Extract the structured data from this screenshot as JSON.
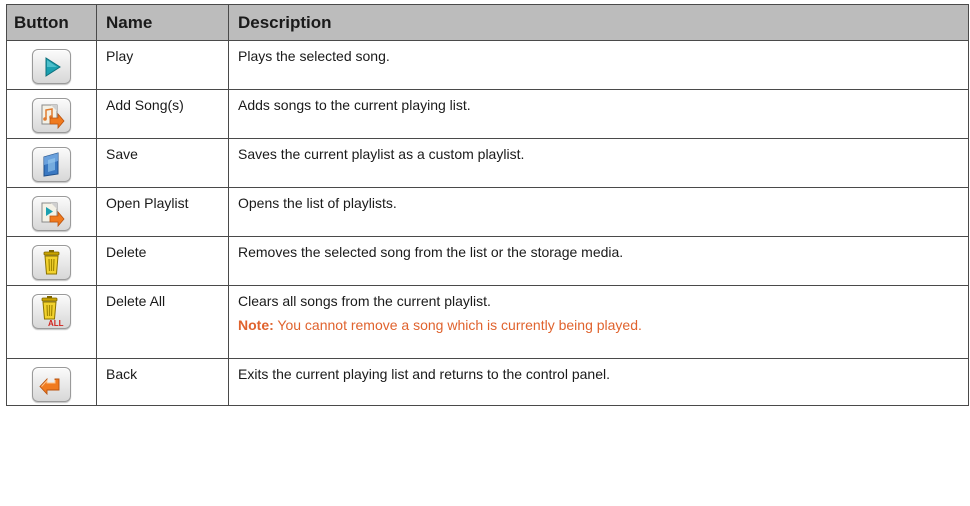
{
  "header": {
    "button": "Button",
    "name": "Name",
    "description": "Description"
  },
  "rows": [
    {
      "icon": "play-icon",
      "name": "Play",
      "description": "Plays the selected song."
    },
    {
      "icon": "add-songs-icon",
      "name": "Add Song(s)",
      "description": "Adds songs to the current playing list."
    },
    {
      "icon": "save-icon",
      "name": "Save",
      "description": "Saves the current playlist as a custom playlist."
    },
    {
      "icon": "open-playlist-icon",
      "name": "Open Playlist",
      "description": "Opens the list of playlists."
    },
    {
      "icon": "delete-icon",
      "name": "Delete",
      "description": "Removes the selected song from the list or the storage media."
    },
    {
      "icon": "delete-all-icon",
      "name": "Delete All",
      "description": "Clears all songs from the current playlist.",
      "note_label": "Note:",
      "note_text": " You cannot remove a song which is currently being played.",
      "icon_text": "ALL"
    },
    {
      "icon": "back-icon",
      "name": "Back",
      "description": "Exits the current playing list and returns to the control panel."
    }
  ],
  "colors": {
    "header_bg": "#bcbcbc",
    "note": "#e0632e",
    "play": "#1aa0b0",
    "arrow": "#f07a1e"
  }
}
